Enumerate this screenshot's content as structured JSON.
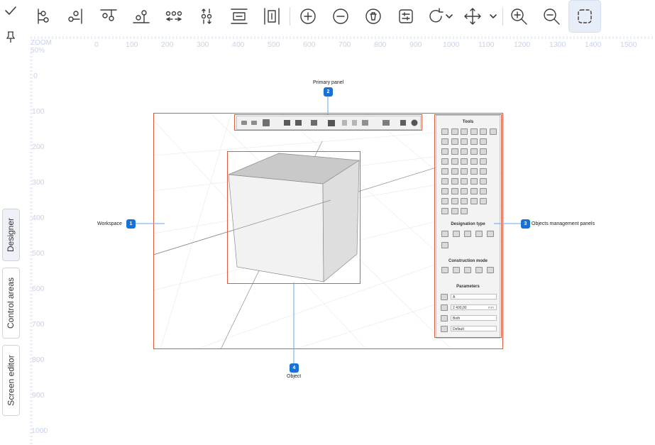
{
  "sidebar": {
    "tabs": [
      {
        "label": "Designer",
        "selected": true
      },
      {
        "label": "Control areas",
        "selected": false
      },
      {
        "label": "Screen editor",
        "selected": false
      }
    ]
  },
  "toolbar": {
    "icons": [
      "check-icon",
      "pin-icon",
      "align-left-icon",
      "distribute-horizontal-icon",
      "align-top-icon",
      "align-bottom-icon",
      "distribute-spacing-icon",
      "distribute-vertical-icon",
      "center-horizontal-icon",
      "center-vertical-icon",
      "add-icon",
      "remove-icon",
      "delete-icon",
      "properties-icon",
      "rotate-icon",
      "move-icon",
      "zoom-in-icon",
      "zoom-out-icon",
      "selection-icon"
    ],
    "active_tool": "selection-icon"
  },
  "rulers": {
    "zoom_label": "ZOOM",
    "zoom_value": "50%",
    "horizontal": [
      "0",
      "100",
      "200",
      "300",
      "400",
      "500",
      "600",
      "700",
      "800",
      "900",
      "1000",
      "1100",
      "1200",
      "1300",
      "1400",
      "1500"
    ],
    "vertical": [
      "0",
      "100",
      "200",
      "300",
      "400",
      "500",
      "600",
      "700",
      "800",
      "900",
      "1000"
    ]
  },
  "screenshot": {
    "callouts": [
      {
        "number": "1",
        "text": "Workspace"
      },
      {
        "number": "2",
        "text": "Primary panel"
      },
      {
        "number": "3",
        "text": "Objects management panels"
      },
      {
        "number": "4",
        "text": "Object"
      }
    ],
    "tools_title": "Tools",
    "designation_title": "Designation type",
    "construction_title": "Construction mode",
    "parameters_title": "Parameters",
    "param_name_value": "A",
    "param_length_value": "2 400,00",
    "param_length_unit": "mm",
    "param_visibility_value": "Both",
    "param_font_value": "Default"
  },
  "colors": {
    "frame": "#e05a3c",
    "callout": "#1672d8",
    "ruler_text": "#c8d0ee",
    "active_bg": "#e8eef8"
  }
}
